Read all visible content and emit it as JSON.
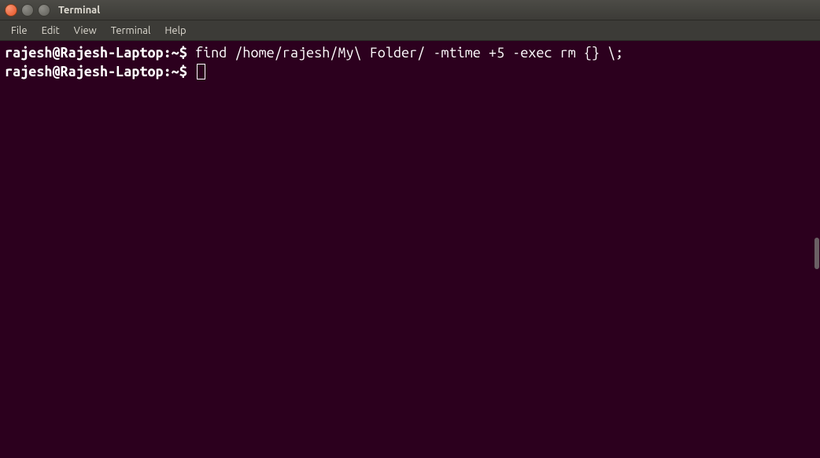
{
  "window": {
    "title": "Terminal"
  },
  "menubar": {
    "items": [
      "File",
      "Edit",
      "View",
      "Terminal",
      "Help"
    ]
  },
  "terminal": {
    "lines": [
      {
        "prompt": "rajesh@Rajesh-Laptop:~$ ",
        "command": "find /home/rajesh/My\\ Folder/ -mtime +5 -exec rm {} \\;"
      },
      {
        "prompt": "rajesh@Rajesh-Laptop:~$ ",
        "command": ""
      }
    ]
  }
}
